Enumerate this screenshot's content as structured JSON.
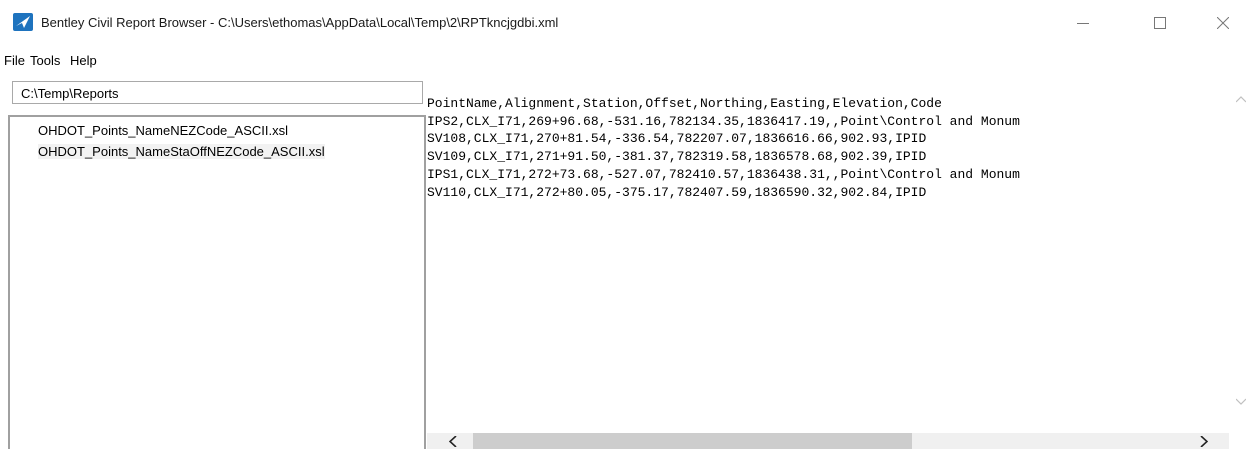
{
  "window": {
    "title": "Bentley Civil Report Browser - C:\\Users\\ethomas\\AppData\\Local\\Temp\\2\\RPTkncjgdbi.xml",
    "icon": "bentley-app-icon",
    "controls": [
      "minimize-icon",
      "maximize-icon",
      "close-icon"
    ]
  },
  "menu": {
    "file": "File",
    "tools": "Tools",
    "help": "Help"
  },
  "folder_path": "C:\\Temp\\Reports",
  "stylesheets": [
    {
      "label": "OHDOT_Points_NameNEZCode_ASCII.xsl",
      "selected": false
    },
    {
      "label": "OHDOT_Points_NameStaOffNEZCode_ASCII.xsl",
      "selected": true
    }
  ],
  "report": {
    "lines": [
      "PointName,Alignment,Station,Offset,Northing,Easting,Elevation,Code",
      "IPS2,CLX_I71,269+96.68,-531.16,782134.35,1836417.19,,Point\\Control and Monum",
      "SV108,CLX_I71,270+81.54,-336.54,782207.07,1836616.66,902.93,IPID",
      "SV109,CLX_I71,271+91.50,-381.37,782319.58,1836578.68,902.39,IPID",
      "IPS1,CLX_I71,272+73.68,-527.07,782410.57,1836438.31,,Point\\Control and Monum",
      "SV110,CLX_I71,272+80.05,-375.17,782407.59,1836590.32,902.84,IPID"
    ]
  },
  "scrollbar_icons": [
    "scroll-up-icon",
    "scroll-down-icon",
    "scroll-left-icon",
    "scroll-right-icon"
  ],
  "colors": {
    "accent": "#1e73be",
    "selection": "#f2f2f2",
    "border": "#a0a0a0"
  }
}
